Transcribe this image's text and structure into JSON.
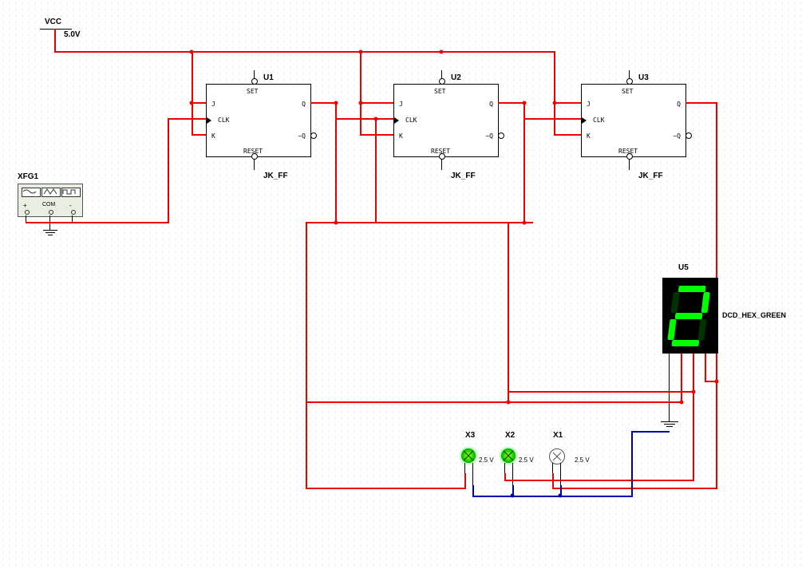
{
  "power": {
    "name": "VCC",
    "value": "5.0V"
  },
  "instrument": {
    "ref": "XFG1",
    "terminals": [
      "+",
      "COM",
      "-"
    ]
  },
  "flipflops": [
    {
      "ref": "U1",
      "type": "JK_FF",
      "pins": {
        "set": "SET",
        "reset": "RESET",
        "j": "J",
        "k": "K",
        "clk": "CLK",
        "q": "Q",
        "qbar": "~Q"
      }
    },
    {
      "ref": "U2",
      "type": "JK_FF",
      "pins": {
        "set": "SET",
        "reset": "RESET",
        "j": "J",
        "k": "K",
        "clk": "CLK",
        "q": "Q",
        "qbar": "~Q"
      }
    },
    {
      "ref": "U3",
      "type": "JK_FF",
      "pins": {
        "set": "SET",
        "reset": "RESET",
        "j": "J",
        "k": "K",
        "clk": "CLK",
        "q": "Q",
        "qbar": "~Q"
      }
    }
  ],
  "display": {
    "ref": "U5",
    "type": "DCD_HEX_GREEN",
    "value": "2"
  },
  "probes": [
    {
      "ref": "X3",
      "voltage": "2.5 V",
      "on": true
    },
    {
      "ref": "X2",
      "voltage": "2.5 V",
      "on": true
    },
    {
      "ref": "X1",
      "voltage": "2.5 V",
      "on": false
    }
  ]
}
